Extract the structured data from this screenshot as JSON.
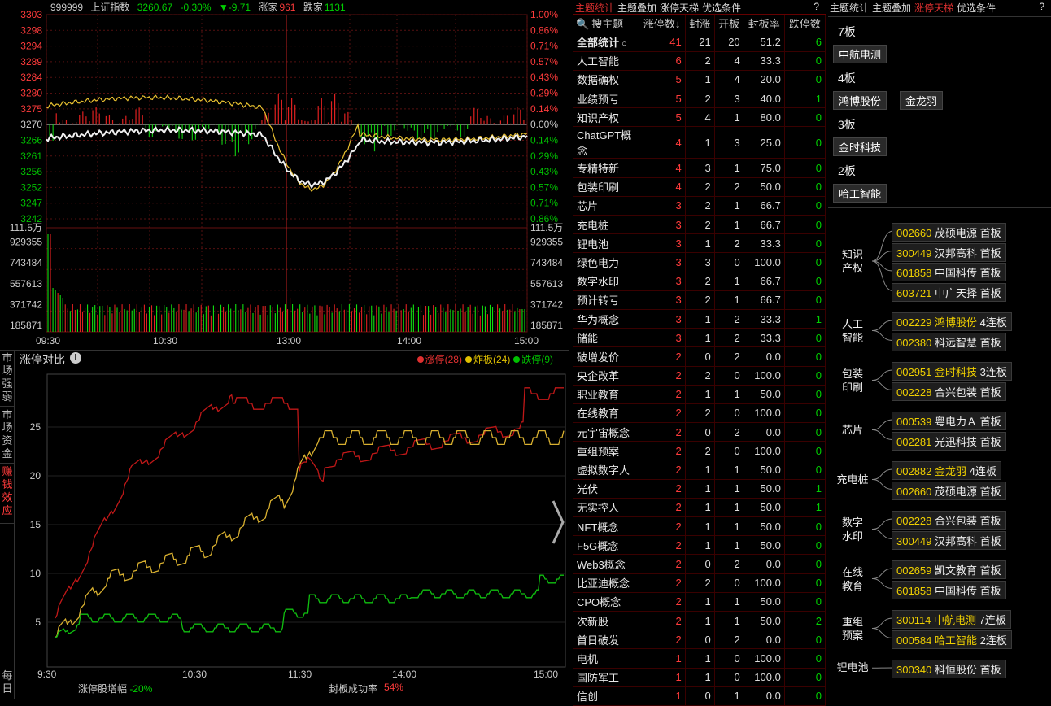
{
  "ticker": {
    "code": "999999",
    "name": "上证指数",
    "price": "3260.67",
    "change_pct": "-0.30%",
    "change": "▼-9.71",
    "up_label": "涨家",
    "up_count": "961",
    "down_label": "跌家",
    "down_count": "1131"
  },
  "price_axis_left": [
    "3303",
    "3298",
    "3294",
    "3289",
    "3284",
    "3280",
    "3275",
    "3270",
    "3266",
    "3261",
    "3256",
    "3252",
    "3247",
    "3242",
    "111.5万",
    "929355",
    "743484",
    "557613",
    "371742",
    "185871"
  ],
  "price_axis_right": [
    "1.00%",
    "0.86%",
    "0.71%",
    "0.57%",
    "0.43%",
    "0.29%",
    "0.14%",
    "0.00%",
    "0.14%",
    "0.29%",
    "0.43%",
    "0.57%",
    "0.71%",
    "0.86%",
    "111.5万",
    "929355",
    "743484",
    "557613",
    "371742",
    "185871"
  ],
  "time_axis_top": [
    "09:30",
    "10:30",
    "13:00",
    "14:00",
    "15:00"
  ],
  "bottom": {
    "title": "涨停对比",
    "legend": [
      {
        "label": "涨停(28)",
        "color": "#e03030"
      },
      {
        "label": "炸板(24)",
        "color": "#e0c000"
      },
      {
        "label": "跌停(9)",
        "color": "#00c000"
      }
    ],
    "y_ticks": [
      "25",
      "20",
      "15",
      "10",
      "5"
    ],
    "x_ticks": [
      "9:30",
      "10:30",
      "11:30",
      "14:00",
      "15:00"
    ],
    "footer_left_label": "涨停股增幅",
    "footer_left_value": "-20%",
    "footer_right_label": "封板成功率",
    "footer_right_value": "54%",
    "side_tabs": [
      "市场强弱",
      "市场资金",
      "赚钱效应"
    ],
    "side_bottom": "每日"
  },
  "mid": {
    "tabs": [
      "主题统计",
      "主题叠加",
      "涨停天梯",
      "优选条件"
    ],
    "help": "?",
    "headers": [
      "搜主题",
      "涨停数↓",
      "封涨",
      "开板",
      "封板率",
      "跌停数"
    ],
    "rows": [
      [
        "全部统计",
        "41",
        "21",
        "20",
        "51.2",
        "6"
      ],
      [
        "人工智能",
        "6",
        "2",
        "4",
        "33.3",
        "0"
      ],
      [
        "数据确权",
        "5",
        "1",
        "4",
        "20.0",
        "0"
      ],
      [
        "业绩预亏",
        "5",
        "2",
        "3",
        "40.0",
        "1"
      ],
      [
        "知识产权",
        "5",
        "4",
        "1",
        "80.0",
        "0"
      ],
      [
        "ChatGPT概念",
        "4",
        "1",
        "3",
        "25.0",
        "0"
      ],
      [
        "专精特新",
        "4",
        "3",
        "1",
        "75.0",
        "0"
      ],
      [
        "包装印刷",
        "4",
        "2",
        "2",
        "50.0",
        "0"
      ],
      [
        "芯片",
        "3",
        "2",
        "1",
        "66.7",
        "0"
      ],
      [
        "充电桩",
        "3",
        "2",
        "1",
        "66.7",
        "0"
      ],
      [
        "锂电池",
        "3",
        "1",
        "2",
        "33.3",
        "0"
      ],
      [
        "绿色电力",
        "3",
        "3",
        "0",
        "100.0",
        "0"
      ],
      [
        "数字水印",
        "3",
        "2",
        "1",
        "66.7",
        "0"
      ],
      [
        "预计转亏",
        "3",
        "2",
        "1",
        "66.7",
        "0"
      ],
      [
        "华为概念",
        "3",
        "1",
        "2",
        "33.3",
        "1"
      ],
      [
        "储能",
        "3",
        "1",
        "2",
        "33.3",
        "0"
      ],
      [
        "破增发价",
        "2",
        "0",
        "2",
        "0.0",
        "0"
      ],
      [
        "央企改革",
        "2",
        "2",
        "0",
        "100.0",
        "0"
      ],
      [
        "职业教育",
        "2",
        "1",
        "1",
        "50.0",
        "0"
      ],
      [
        "在线教育",
        "2",
        "2",
        "0",
        "100.0",
        "0"
      ],
      [
        "元宇宙概念",
        "2",
        "0",
        "2",
        "0.0",
        "0"
      ],
      [
        "重组预案",
        "2",
        "2",
        "0",
        "100.0",
        "0"
      ],
      [
        "虚拟数字人",
        "2",
        "1",
        "1",
        "50.0",
        "0"
      ],
      [
        "光伏",
        "2",
        "1",
        "1",
        "50.0",
        "1"
      ],
      [
        "无实控人",
        "2",
        "1",
        "1",
        "50.0",
        "1"
      ],
      [
        "NFT概念",
        "2",
        "1",
        "1",
        "50.0",
        "0"
      ],
      [
        "F5G概念",
        "2",
        "1",
        "1",
        "50.0",
        "0"
      ],
      [
        "Web3概念",
        "2",
        "0",
        "2",
        "0.0",
        "0"
      ],
      [
        "比亚迪概念",
        "2",
        "2",
        "0",
        "100.0",
        "0"
      ],
      [
        "CPO概念",
        "2",
        "1",
        "1",
        "50.0",
        "0"
      ],
      [
        "次新股",
        "2",
        "1",
        "1",
        "50.0",
        "2"
      ],
      [
        "首日破发",
        "2",
        "0",
        "2",
        "0.0",
        "0"
      ],
      [
        "电机",
        "1",
        "1",
        "0",
        "100.0",
        "0"
      ],
      [
        "国防军工",
        "1",
        "1",
        "0",
        "100.0",
        "0"
      ],
      [
        "信创",
        "1",
        "0",
        "1",
        "0.0",
        "0"
      ]
    ]
  },
  "right": {
    "tabs": [
      "主题统计",
      "主题叠加",
      "涨停天梯",
      "优选条件"
    ],
    "help": "?",
    "ladder": [
      {
        "level": "7板",
        "stocks": [
          "中航电测"
        ]
      },
      {
        "level": "4板",
        "stocks": [
          "鸿博股份",
          "金龙羽"
        ]
      },
      {
        "level": "3板",
        "stocks": [
          "金时科技"
        ]
      },
      {
        "level": "2板",
        "stocks": [
          "哈工智能"
        ]
      }
    ],
    "groups": [
      {
        "theme": "知识\n产权",
        "items": [
          [
            "002660",
            "茂硕电源",
            "首板"
          ],
          [
            "300449",
            "汉邦高科",
            "首板"
          ],
          [
            "601858",
            "中国科传",
            "首板"
          ],
          [
            "603721",
            "中广天择",
            "首板"
          ]
        ]
      },
      {
        "theme": "人工\n智能",
        "items": [
          [
            "002229",
            "鸿博股份",
            "4连板"
          ],
          [
            "002380",
            "科远智慧",
            "首板"
          ]
        ]
      },
      {
        "theme": "包装\n印刷",
        "items": [
          [
            "002951",
            "金时科技",
            "3连板"
          ],
          [
            "002228",
            "合兴包装",
            "首板"
          ]
        ]
      },
      {
        "theme": "芯片",
        "items": [
          [
            "000539",
            "粤电力Ａ",
            "首板"
          ],
          [
            "002281",
            "光迅科技",
            "首板"
          ]
        ]
      },
      {
        "theme": "充电桩",
        "items": [
          [
            "002882",
            "金龙羽",
            "4连板"
          ],
          [
            "002660",
            "茂硕电源",
            "首板"
          ]
        ]
      },
      {
        "theme": "数字\n水印",
        "items": [
          [
            "002228",
            "合兴包装",
            "首板"
          ],
          [
            "300449",
            "汉邦高科",
            "首板"
          ]
        ]
      },
      {
        "theme": "在线\n教育",
        "items": [
          [
            "002659",
            "凯文教育",
            "首板"
          ],
          [
            "601858",
            "中国科传",
            "首板"
          ]
        ]
      },
      {
        "theme": "重组\n预案",
        "items": [
          [
            "300114",
            "中航电测",
            "7连板"
          ],
          [
            "000584",
            "哈工智能",
            "2连板"
          ]
        ]
      },
      {
        "theme": "锂电池",
        "items": [
          [
            "300340",
            "科恒股份",
            "首板"
          ]
        ]
      }
    ]
  }
}
